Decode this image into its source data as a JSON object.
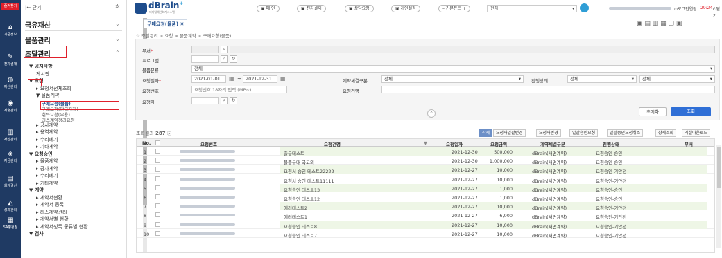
{
  "app": {
    "logo_text": "dBrain",
    "logo_sup": "+",
    "logo_subtitle": "디지털예산회계시스템",
    "top_link": "|← 닫기",
    "rail_badge": "즐겨찾기"
  },
  "rail": [
    {
      "label": "",
      "icon": "search-icon"
    },
    {
      "label": "기준정보",
      "icon": "home-icon"
    },
    {
      "label": "전자결재",
      "icon": "pen-icon"
    },
    {
      "label": "예산관리",
      "icon": "budget-icon"
    },
    {
      "label": "지출관리",
      "icon": "expense-icon"
    },
    {
      "label": "자산관리",
      "icon": "asset-icon"
    },
    {
      "label": "자금관리",
      "icon": "fund-icon"
    },
    {
      "label": "회계결산",
      "icon": "ledger-icon"
    },
    {
      "label": "성과관리",
      "icon": "chart-icon"
    },
    {
      "label": "SA평정정",
      "icon": "sa-icon"
    }
  ],
  "menu": {
    "sections": [
      "국유재산",
      "물품관리",
      "조달관리"
    ],
    "items": [
      "▼ 공지사항",
      "게시판",
      "▼ 요청",
      "▸ 요청서전체조회",
      "▼ 물품계약",
      "구매요청(물품)",
      "구매요청(판급자재)",
      "취득요청(무용)",
      "리스계약정리요청",
      "▸ 공사계약",
      "▸ 용역계약",
      "▸ 수리폐기",
      "▸ 기타계약",
      "▼ 요청승인",
      "▸ 물품계약",
      "▸ 공사계약",
      "▸ 수리폐기",
      "▸ 기타계약",
      "▼ 계약",
      "▸ 계약서현황",
      "▸ 계약서 등록",
      "▸ 리스계약관리",
      "▸ 계약서별 현황",
      "▸ 계약서성록 종류별 현황",
      "▼ 검사"
    ]
  },
  "topbar": {
    "buttons": [
      "메 인",
      "전자결재",
      "상담요청",
      "개인설정"
    ],
    "base_font": "– 기본폰트 +",
    "select_value": "전체",
    "logout": "로그인연장",
    "timer": "29:24",
    "close": "닫기"
  },
  "tab": {
    "label": "구매요청(물품)",
    "close": "✕"
  },
  "breadcrumb": "조달관리 > 요청 > 물품계약 > 구매요청(물품)",
  "form": {
    "dept_label": "부서",
    "program_label": "프로그램",
    "category_label": "물품분류",
    "category_value": "전체",
    "req_date_label": "요청일자",
    "date_from": "2021-01-01",
    "date_to": "2021-12-31",
    "contract_type_label": "계약체결구분",
    "contract_type_value": "전체",
    "status_label": "진행상태",
    "status_value": "전체",
    "status_value2": "전체",
    "req_no_label": "요청번호",
    "req_no_placeholder": "요청번호 18자리 입력 (MP~)",
    "req_name_label": "요청건명",
    "requester_label": "요청자",
    "reset_btn": "초기화",
    "search_btn": "조회"
  },
  "result": {
    "label": "조회결과",
    "count": "287",
    "tools": [
      "삭제",
      "요청자일괄변경",
      "요청자변경",
      "일괄승인요청",
      "일괄승인요청취소",
      "상세조회",
      "엑셀다운로드"
    ]
  },
  "grid": {
    "headers": [
      "No.",
      "요청번호",
      "요청건명",
      "요청일자",
      "요청금액",
      "계약체결구분",
      "진행상태",
      "부서"
    ],
    "rows": [
      {
        "no": "1",
        "name": "출급테스트",
        "date": "2021-12-30",
        "amount": "500,000",
        "type": "dBrain(서면계약)",
        "status": "요청승인-승인",
        "hl": true
      },
      {
        "no": "2",
        "name": "물품구매 국고외",
        "date": "2021-12-30",
        "amount": "1,000,000",
        "type": "dBrain(서면계약)",
        "status": "요청승인-승인",
        "hl": false
      },
      {
        "no": "3",
        "name": "요청서 승인 테스트22222",
        "date": "2021-12-27",
        "amount": "10,000",
        "type": "dBrain(서면계약)",
        "status": "요청승인-기안전",
        "hl": true
      },
      {
        "no": "4",
        "name": "요청서 승인 테스트11111",
        "date": "2021-12-27",
        "amount": "10,000",
        "type": "dBrain(서면계약)",
        "status": "요청승인-기안전",
        "hl": false
      },
      {
        "no": "5",
        "name": "요청승인 테스트13",
        "date": "2021-12-27",
        "amount": "1,000",
        "type": "dBrain(서면계약)",
        "status": "요청승인-승인",
        "hl": true
      },
      {
        "no": "6",
        "name": "요청승인 테스트12",
        "date": "2021-12-27",
        "amount": "1,000",
        "type": "dBrain(서면계약)",
        "status": "요청승인-승인",
        "hl": false
      },
      {
        "no": "7",
        "name": "에러테스트2",
        "date": "2021-12-27",
        "amount": "10,000",
        "type": "dBrain(서면계약)",
        "status": "요청승인-기안전",
        "hl": true
      },
      {
        "no": "8",
        "name": "에러테스트1",
        "date": "2021-12-27",
        "amount": "6,000",
        "type": "dBrain(서면계약)",
        "status": "요청승인-기안전",
        "hl": false
      },
      {
        "no": "9",
        "name": "요청승인 테스트8",
        "date": "2021-12-27",
        "amount": "10,000",
        "type": "dBrain(서면계약)",
        "status": "요청승인-기안전",
        "hl": true
      },
      {
        "no": "10",
        "name": "요청승인 테스트7",
        "date": "2021-12-27",
        "amount": "10,000",
        "type": "dBrain(서면계약)",
        "status": "요청승인-기안전",
        "hl": false
      }
    ]
  },
  "colors": {
    "rail": "#1f3a63",
    "accent": "#e0202b",
    "search": "#2f6fd6"
  }
}
